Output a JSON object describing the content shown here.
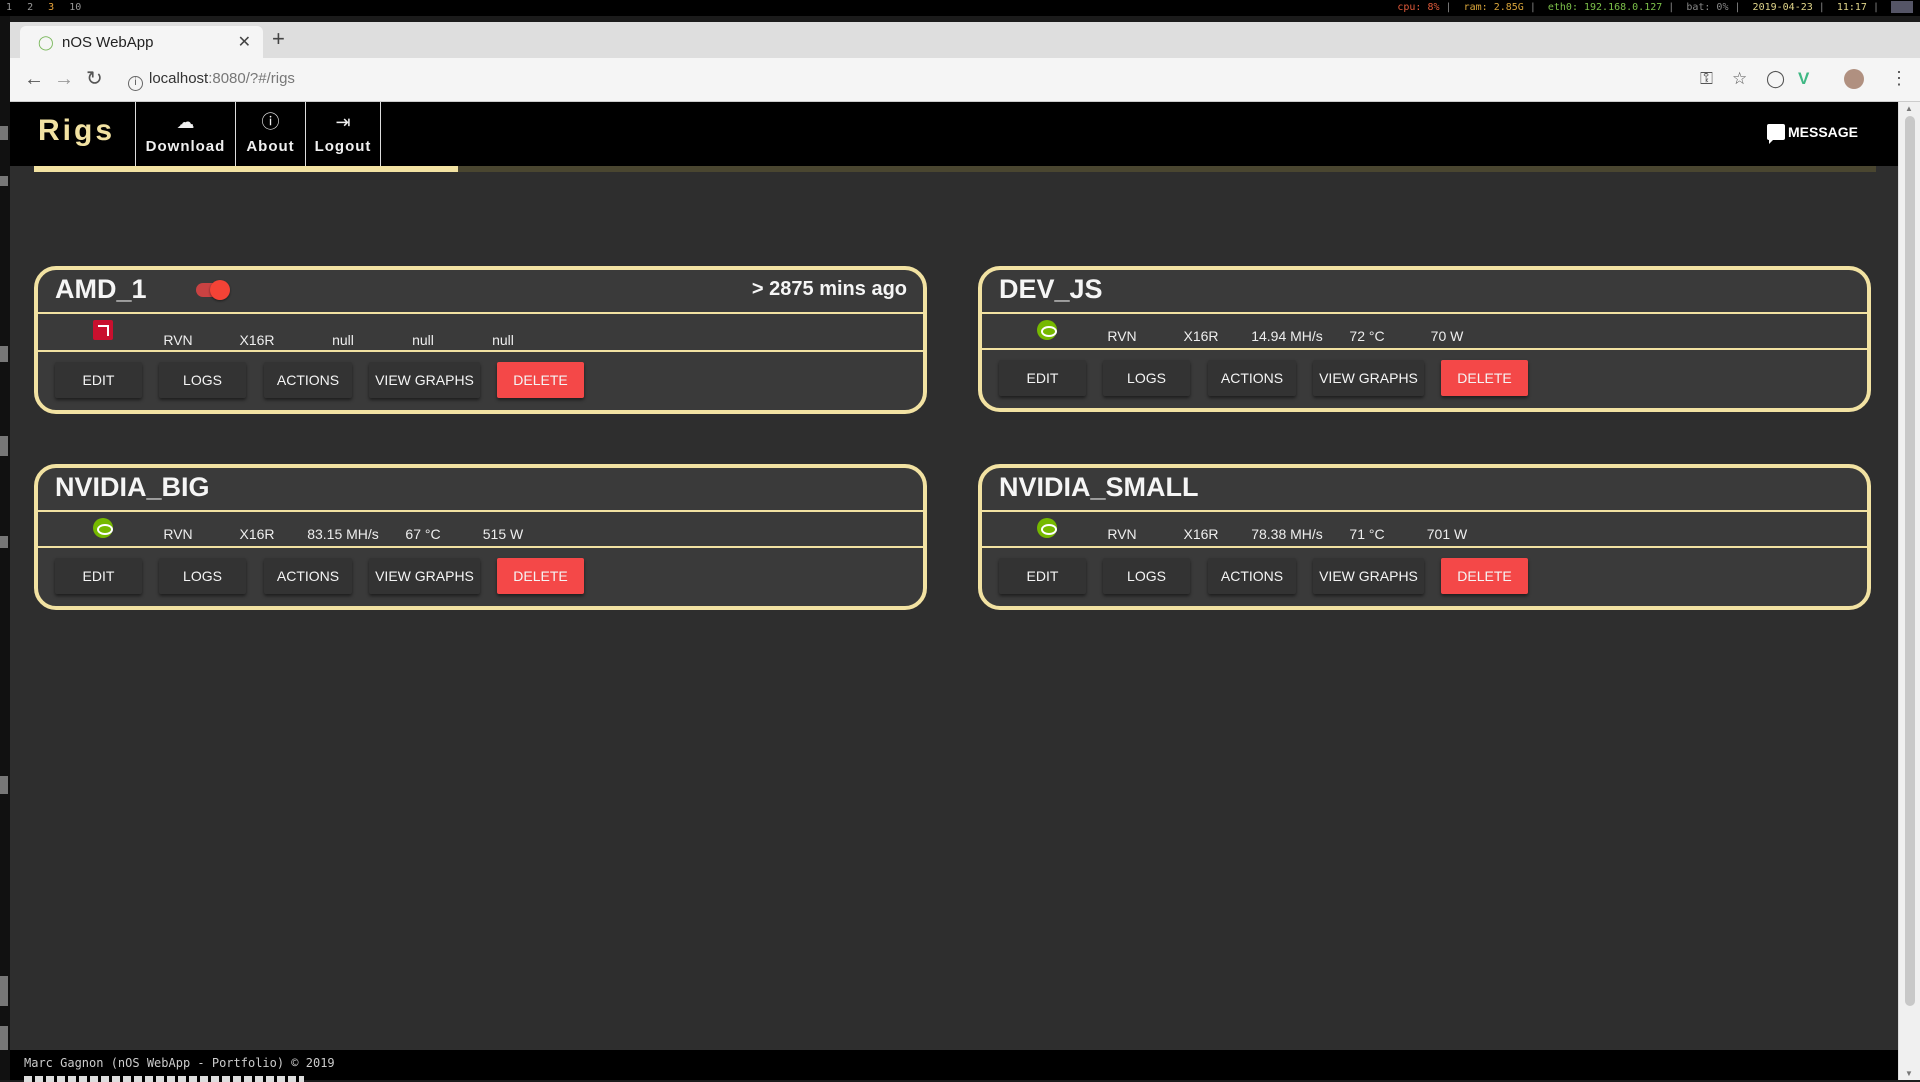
{
  "system_bar": {
    "workspaces": [
      "1",
      "2",
      "3",
      "10"
    ],
    "cpu": "cpu: 8%",
    "ram": "ram: 2.85G",
    "eth": "eth0: 192.168.0.127",
    "bat": "bat: 0%",
    "date": "2019-04-23",
    "time": "11:17"
  },
  "browser": {
    "tab_title": "nOS WebApp",
    "url_host": "localhost",
    "url_path": ":8080/?#/rigs"
  },
  "app": {
    "brand": "Rigs",
    "nav": [
      {
        "label": "Download",
        "icon": "cloud-download-icon"
      },
      {
        "label": "About",
        "icon": "info-icon"
      },
      {
        "label": "Logout",
        "icon": "logout-icon"
      }
    ],
    "message_label": "MESSAGE",
    "progress_fraction": 0.23,
    "colors": {
      "accent": "#f2e2a2",
      "danger": "#f44848",
      "card_bg": "#3a3a3a"
    }
  },
  "rigs": [
    {
      "name": "AMD_1",
      "gpu": "amd-icon",
      "toggle_on": true,
      "last_seen": "> 2875 mins ago",
      "stats": [
        "RVN",
        "X16R",
        "null",
        "null",
        "null"
      ]
    },
    {
      "name": "DEV_JS",
      "gpu": "nvidia-icon",
      "stats": [
        "RVN",
        "X16R",
        "14.94 MH/s",
        "72 °C",
        "70 W"
      ]
    },
    {
      "name": "NVIDIA_BIG",
      "gpu": "nvidia-icon",
      "stats": [
        "RVN",
        "X16R",
        "83.15 MH/s",
        "67 °C",
        "515 W"
      ]
    },
    {
      "name": "NVIDIA_SMALL",
      "gpu": "nvidia-icon",
      "stats": [
        "RVN",
        "X16R",
        "78.38 MH/s",
        "71 °C",
        "701 W"
      ]
    }
  ],
  "buttons": {
    "edit": "EDIT",
    "logs": "LOGS",
    "actions": "ACTIONS",
    "graphs": "VIEW GRAPHS",
    "delete": "DELETE"
  },
  "footer": "Marc Gagnon (nOS WebApp - Portfolio) © 2019"
}
